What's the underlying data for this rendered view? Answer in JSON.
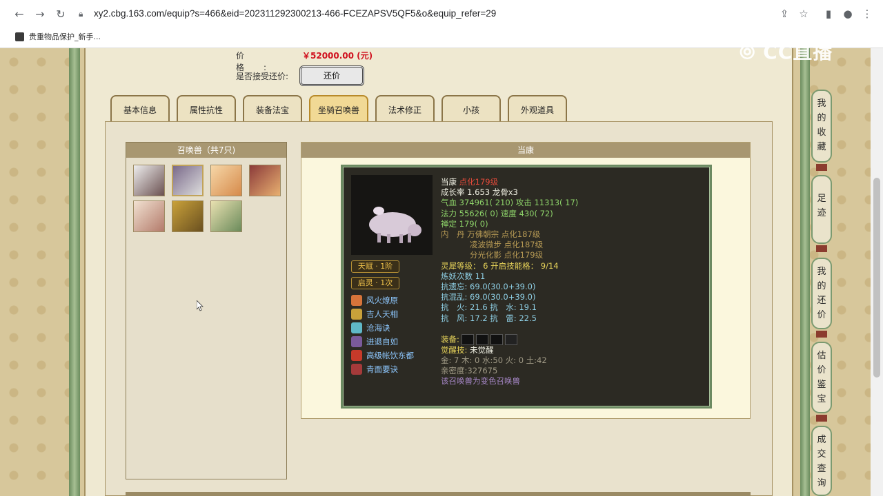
{
  "browser": {
    "url": "xy2.cbg.163.com/equip?s=466&eid=202311292300213-466-FCEZAPSV5QF5&o&equip_refer=29",
    "bookmark": "贵重物品保护_新手..."
  },
  "watermark": "CC直播",
  "price": {
    "label": "价格:",
    "value": "￥52000.00 (元)"
  },
  "bargain": {
    "label": "是否接受还价:",
    "button": "还价"
  },
  "tabs": [
    {
      "label": "基本信息"
    },
    {
      "label": "属性抗性"
    },
    {
      "label": "装备法宝"
    },
    {
      "label": "坐骑召唤兽",
      "active": true
    },
    {
      "label": "法术修正"
    },
    {
      "label": "小孩"
    },
    {
      "label": "外观道具"
    }
  ],
  "pets": {
    "header": "召唤兽（共7只)"
  },
  "detail": {
    "header": "当康",
    "name": "当康",
    "name_suffix": "点化179级",
    "growth": "成长率 1.653 龙骨x3",
    "hp": "气血 374961( 210)",
    "attack": "攻击 11313( 17)",
    "mp": "法力 55626( 0)",
    "speed": "速度 430( 72)",
    "defense": "禅定 179( 0)",
    "inner1": "内　丹 万佛朝宗 点化187级",
    "inner2": "凌波微步 点化187级",
    "inner3": "分光化影 点化179级",
    "spirit": "灵犀等级： 6 开启技能格： 9/14",
    "refine": "炼妖次数 11",
    "resist1": "抗遗忘: 69.0(30.0+39.0)",
    "resist2": "抗混乱: 69.0(30.0+39.0)",
    "resist3": "抗　火: 21.6 抗　水: 19.1",
    "resist4": "抗　风: 17.2 抗　雷: 22.5",
    "equip_label": "装备:",
    "awaken": "觉醒技:",
    "awaken_val": "未觉醒",
    "elements": "金: 7 木: 0 水:50 火: 0 土:42",
    "intimacy": "亲密度:327675",
    "variant": "该召唤兽为变色召唤兽",
    "badge1": "天赋 · 1阶",
    "badge2": "启灵 · 1次",
    "skills": [
      {
        "name": "风火燎原",
        "color": "#d6743a"
      },
      {
        "name": "吉人天相",
        "color": "#c9a13a"
      },
      {
        "name": "沧海诀",
        "color": "#5fb8c7"
      },
      {
        "name": "进退自如",
        "color": "#7a5a9a"
      },
      {
        "name": "高级帐饮东都",
        "color": "#c73a2a"
      },
      {
        "name": "青面要诀",
        "color": "#a53a3a"
      }
    ]
  },
  "sidebar": [
    {
      "label": "我的收藏"
    },
    {
      "label": "足迹"
    },
    {
      "label": "我的还价"
    },
    {
      "label": "估价鉴宝"
    },
    {
      "label": "成交查询"
    }
  ]
}
